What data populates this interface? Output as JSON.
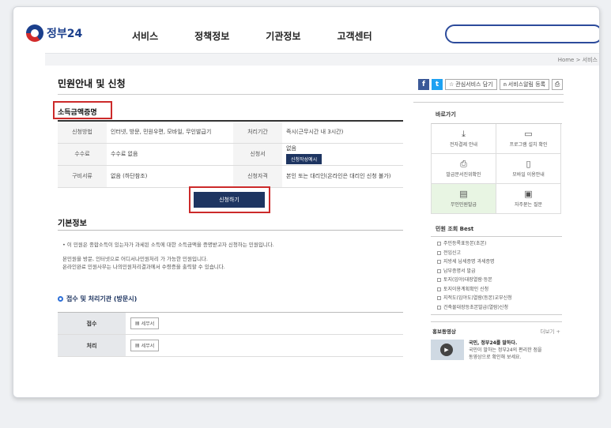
{
  "header": {
    "logo": "정부24",
    "nav": [
      "서비스",
      "정책정보",
      "기관정보",
      "고객센터"
    ],
    "breadcrumb": "Home  >  서비스"
  },
  "page_title": "민원안내 및 신청",
  "toolbar": {
    "facebook": "f",
    "twitter": "t",
    "bookmark": "관심서비스 담기",
    "alarm": "서비스알림 등록"
  },
  "service": {
    "name": "소득금액증명",
    "rows": [
      {
        "label1": "신청방법",
        "value1": "인터넷, 방문, 민원우편, 모바일, 무인발급기",
        "label2": "처리기간",
        "value2": "즉시(근무시간 내 3시간)"
      },
      {
        "label1": "수수료",
        "value1": "수수료 없음",
        "label2": "신청서",
        "value2": "없음",
        "button": "신청작성예시"
      },
      {
        "label1": "구비서류",
        "value1": "없음 (하단참조)",
        "label2": "신청자격",
        "value2": "본인 또는 대리인(온라인은 대리인 신청 불가)"
      }
    ],
    "apply_button": "신청하기"
  },
  "basic_info": {
    "title": "기본정보",
    "line1": "• 이 민원은 종합소득이 있는자가 과세된 소득에 대한 소득금액을 증명받고자 신청하는 민원입니다.",
    "line2": "본민원을 방문, 인터넷으로 어디서나민원처리 가 가능한 민원입니다.",
    "line3": "온라인완료 민원사무는 나의민원처리결과에서 수령증을 출력할 수 있습니다."
  },
  "processing": {
    "title": "접수 및 처리기관 (방문시)",
    "rows": [
      {
        "label": "접수",
        "button": "세무서"
      },
      {
        "label": "처리",
        "button": "세무서"
      }
    ]
  },
  "sidebar": {
    "quick_title": "바로가기",
    "quick": [
      {
        "icon": "download-icon",
        "glyph": "⤓",
        "label": "전자결제 안내"
      },
      {
        "icon": "monitor-icon",
        "glyph": "▭",
        "label": "프로그램 설치 확인"
      },
      {
        "icon": "printer-icon",
        "glyph": "⎙",
        "label": "발급문서진위확인"
      },
      {
        "icon": "mobile-icon",
        "glyph": "▯",
        "label": "모바일 이용안내"
      },
      {
        "icon": "kiosk-icon",
        "glyph": "▤",
        "label": "무인민원발급"
      },
      {
        "icon": "chat-icon",
        "glyph": "▣",
        "label": "자주묻는 질문"
      }
    ],
    "best_title": "민원 조회 Best",
    "best": [
      "주민등록표등본(초본)",
      "전입신고",
      "지방세 납세증명 과세증명",
      "납부증명서 발급",
      "토지(임야)대장열람·등본",
      "토지이용계획확인 신청",
      "지적도(임야도)열람(등본)교부신청",
      "건축물대장등초본발급(열람)신청"
    ],
    "promo_title": "홍보동영상",
    "promo_more": "더보기 +",
    "promo_line1": "국민, 정부24를 말하다.",
    "promo_line2": "국민이 말하는 정부24의 편리한 점을",
    "promo_line3": "동영상으로 확인해 보세요."
  },
  "colors": {
    "navy": "#1e3561",
    "highlight_red": "#cc2a2a",
    "brand_blue": "#1b3f8c",
    "active_green": "#e8f5e3"
  }
}
